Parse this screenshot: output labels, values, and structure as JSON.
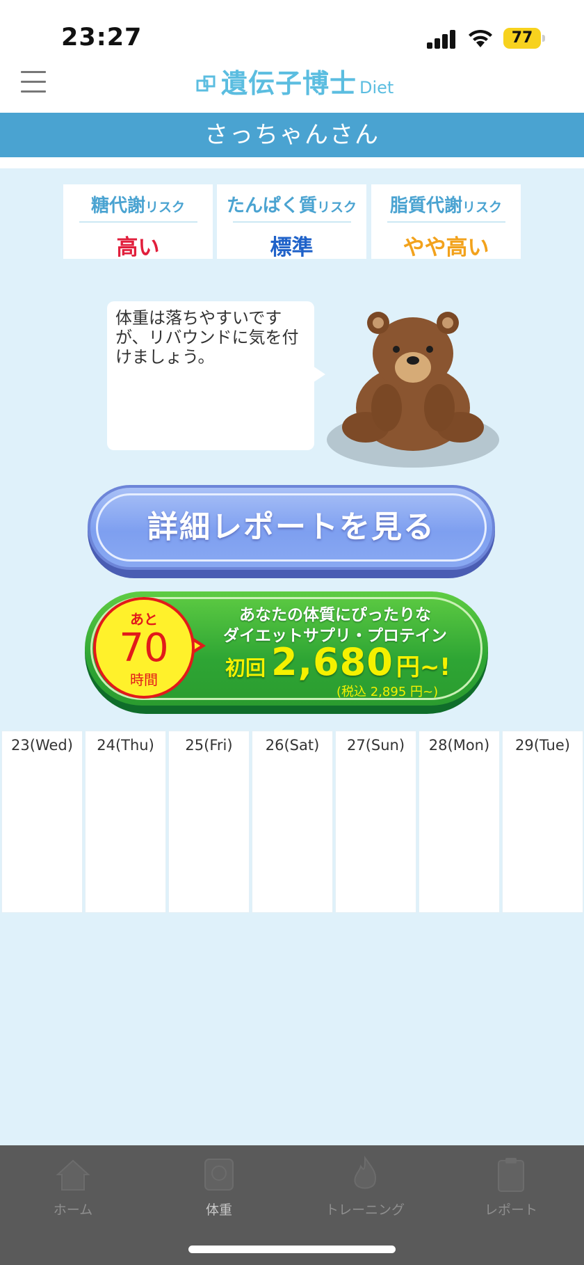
{
  "status": {
    "time": "23:27",
    "battery": "77"
  },
  "header": {
    "logo_main": "遺伝子博士",
    "logo_sub": "Diet"
  },
  "user": {
    "name": "さっちゃんさん"
  },
  "risks": [
    {
      "title": "糖代謝",
      "suffix": "リスク",
      "value": "高い",
      "color": "#e11f3c"
    },
    {
      "title": "たんぱく質",
      "suffix": "リスク",
      "value": "標準",
      "color": "#1f62c9"
    },
    {
      "title": "脂質代謝",
      "suffix": "リスク",
      "value": "やや高い",
      "color": "#f2a21c"
    }
  ],
  "advice": {
    "text": "体重は落ちやすいですが、リバウンドに気を付けましょう。"
  },
  "report_button": {
    "label": "詳細レポートを見る"
  },
  "promo": {
    "countdown_prefix": "あと",
    "countdown_value": "70",
    "countdown_unit": "時間",
    "line1": "あなたの体質にぴったりな",
    "line2": "ダイエットサプリ・プロテイン",
    "first_label": "初回",
    "price": "2,680",
    "price_suffix": "円~!",
    "tax_note": "(税込 2,895 円~)"
  },
  "calendar": {
    "days": [
      "23(Wed)",
      "24(Thu)",
      "25(Fri)",
      "26(Sat)",
      "27(Sun)",
      "28(Mon)",
      "29(Tue)"
    ]
  },
  "tabs": [
    {
      "label": "ホーム",
      "icon": "home-icon"
    },
    {
      "label": "体重",
      "icon": "scale-icon"
    },
    {
      "label": "トレーニング",
      "icon": "flame-icon"
    },
    {
      "label": "レポート",
      "icon": "clipboard-icon"
    }
  ],
  "colors": {
    "brand": "#5bbde0",
    "name_bar": "#4aa3d1",
    "background": "#dff1fa",
    "tabbar": "#5a5a5a"
  }
}
